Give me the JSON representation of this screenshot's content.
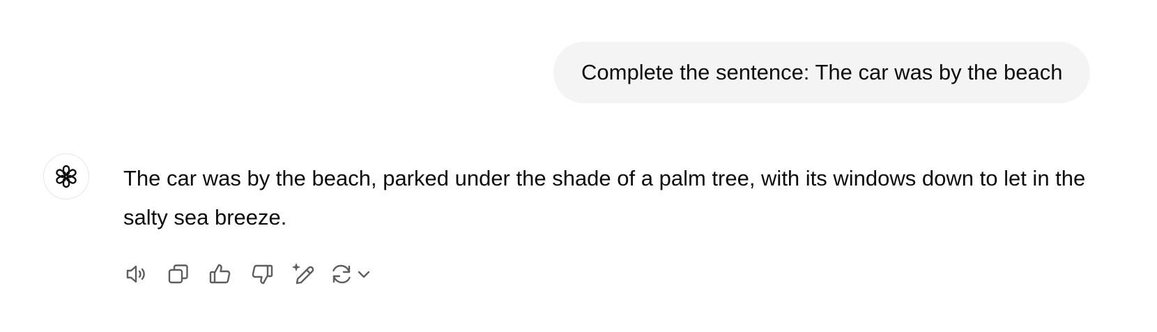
{
  "user_message": {
    "text": "Complete the sentence: The car was by the beach"
  },
  "assistant_message": {
    "avatar_icon": "openai-logo-icon",
    "text": "The car was by the beach, parked under the shade of a palm tree, with its windows down to let in the salty sea breeze."
  },
  "actions": [
    {
      "id": "read-aloud",
      "icon": "speaker-icon"
    },
    {
      "id": "copy",
      "icon": "copy-icon"
    },
    {
      "id": "good-response",
      "icon": "thumbs-up-icon"
    },
    {
      "id": "bad-response",
      "icon": "thumbs-down-icon"
    },
    {
      "id": "edit-in-canvas",
      "icon": "pencil-sparkle-icon"
    },
    {
      "id": "regenerate",
      "icon": "refresh-icon",
      "has_dropdown": true
    }
  ],
  "colors": {
    "bubble_bg": "#f4f4f4",
    "text": "#0d0d0d",
    "icon": "#5d5d5d"
  }
}
